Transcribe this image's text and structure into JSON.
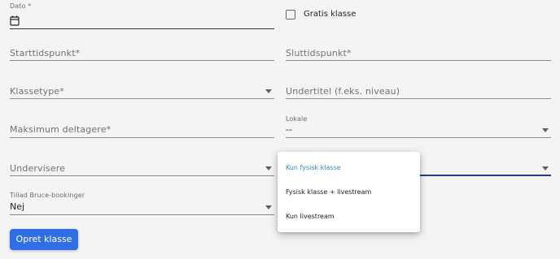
{
  "form": {
    "date": {
      "label": "Dato *"
    },
    "free_class": {
      "label": "Gratis klasse",
      "checked": false
    },
    "start_time": {
      "placeholder": "Starttidspunkt*"
    },
    "end_time": {
      "placeholder": "Sluttidspunkt*"
    },
    "class_type": {
      "placeholder": "Klassetype*"
    },
    "subtitle": {
      "placeholder": "Undertitel (f.eks. niveau)"
    },
    "max_participants": {
      "placeholder": "Maksimum deltagere*"
    },
    "venue": {
      "label": "Lokale",
      "value": "--"
    },
    "instructors": {
      "placeholder": "Undervisere"
    },
    "bruce_bookings": {
      "label": "Tillad Bruce-bookinger",
      "value": "Nej"
    },
    "submit_label": "Opret klasse"
  },
  "dropdown": {
    "options": [
      {
        "label": "Kun fysisk klasse",
        "selected": true
      },
      {
        "label": "Fysisk klasse + livestream",
        "selected": false
      },
      {
        "label": "Kun livestream",
        "selected": false
      }
    ]
  },
  "colors": {
    "accent_button": "#2f6ee5",
    "selected_option": "#2a8bb3",
    "active_underline": "#1f3b9a"
  },
  "icons": {
    "date": "calendar-icon",
    "select": "chevron-down-icon"
  }
}
